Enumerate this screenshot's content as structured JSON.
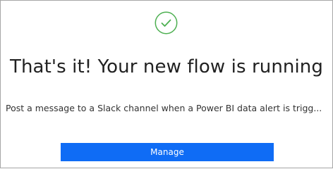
{
  "icons": {
    "success": "check-circle-icon"
  },
  "colors": {
    "success_green": "#4caf50",
    "primary_button": "#0f6cf5"
  },
  "confirmation": {
    "title": "That's it! Your new flow is running",
    "description": "Post a message to a Slack channel when a Power BI data alert is trigg...",
    "manage_label": "Manage"
  }
}
